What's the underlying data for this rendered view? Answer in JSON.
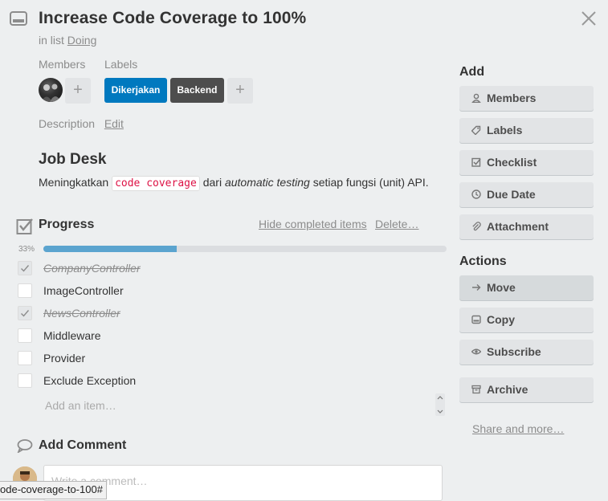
{
  "card": {
    "title": "Increase Code Coverage to 100%",
    "in_list_prefix": "in list",
    "list_name": "Doing"
  },
  "members": {
    "heading": "Members"
  },
  "labels": {
    "heading": "Labels",
    "items": [
      {
        "text": "Dikerjakan",
        "color": "#0079bf"
      },
      {
        "text": "Backend",
        "color": "#4d4d4d"
      }
    ]
  },
  "description": {
    "heading": "Description",
    "edit_label": "Edit",
    "job_title": "Job Desk",
    "text_before": "Meningkatkan",
    "code": "code coverage",
    "text_mid": "dari",
    "italic": "automatic testing",
    "text_after": "setiap fungsi (unit) API."
  },
  "checklist": {
    "title": "Progress",
    "hide_label": "Hide completed items",
    "delete_label": "Delete…",
    "percent_text": "33%",
    "progress": 0.33,
    "items": [
      {
        "text": "CompanyController",
        "done": true
      },
      {
        "text": "ImageController",
        "done": false
      },
      {
        "text": "NewsController",
        "done": true
      },
      {
        "text": "Middleware",
        "done": false
      },
      {
        "text": "Provider",
        "done": false
      },
      {
        "text": "Exclude Exception",
        "done": false
      }
    ],
    "add_placeholder": "Add an item…"
  },
  "comment": {
    "title": "Add Comment",
    "placeholder": "Write a comment…"
  },
  "sidebar": {
    "add_heading": "Add",
    "add_buttons": [
      {
        "label": "Members",
        "icon": "person-icon"
      },
      {
        "label": "Labels",
        "icon": "tag-icon"
      },
      {
        "label": "Checklist",
        "icon": "checkbox-icon"
      },
      {
        "label": "Due Date",
        "icon": "clock-icon"
      },
      {
        "label": "Attachment",
        "icon": "paperclip-icon"
      }
    ],
    "actions_heading": "Actions",
    "action_buttons": [
      {
        "label": "Move",
        "icon": "arrow-right-icon"
      },
      {
        "label": "Copy",
        "icon": "card-icon"
      },
      {
        "label": "Subscribe",
        "icon": "eye-icon"
      },
      {
        "label": "Archive",
        "icon": "archive-icon"
      }
    ],
    "share_label": "Share and more…"
  },
  "status_bar": {
    "url_fragment": "ode-coverage-to-100#"
  },
  "colors": {
    "progress_fill": "#5ba4cf",
    "accent": "#0079bf"
  }
}
